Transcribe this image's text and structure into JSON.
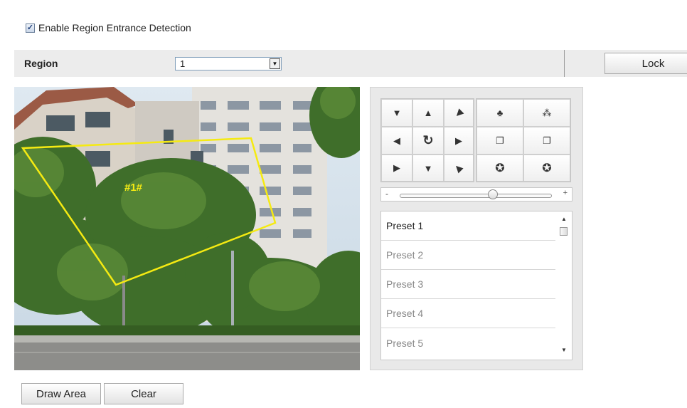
{
  "enable": {
    "label": "Enable Region Entrance Detection",
    "checked": true
  },
  "region": {
    "label": "Region",
    "value": "1",
    "lock_label": "Lock"
  },
  "video": {
    "overlay_label": "#1#",
    "overlay_color": "#f5ea12"
  },
  "ptz": {
    "directions": [
      {
        "name": "up-left",
        "glyph": "▼"
      },
      {
        "name": "up",
        "glyph": "▲"
      },
      {
        "name": "up-right",
        "glyph": "◀"
      },
      {
        "name": "left",
        "glyph": "◀"
      },
      {
        "name": "auto",
        "glyph": "↻"
      },
      {
        "name": "right",
        "glyph": "▶"
      },
      {
        "name": "down-left",
        "glyph": "▶"
      },
      {
        "name": "down",
        "glyph": "▼"
      },
      {
        "name": "down-right",
        "glyph": "◀"
      }
    ],
    "lens": [
      {
        "name": "zoom-in-icon",
        "glyph": "♣"
      },
      {
        "name": "zoom-out-icon",
        "glyph": "⁂"
      },
      {
        "name": "focus-near-icon",
        "glyph": "❐"
      },
      {
        "name": "focus-far-icon",
        "glyph": "❐"
      },
      {
        "name": "iris-open-icon",
        "glyph": "✪"
      },
      {
        "name": "iris-close-icon",
        "glyph": "✪"
      }
    ],
    "speed": {
      "minus": "-",
      "plus": "+",
      "level": 0.62
    }
  },
  "presets": [
    {
      "label": "Preset 1",
      "active": true
    },
    {
      "label": "Preset 2",
      "active": false
    },
    {
      "label": "Preset 3",
      "active": false
    },
    {
      "label": "Preset 4",
      "active": false
    },
    {
      "label": "Preset 5",
      "active": false
    }
  ],
  "buttons": {
    "draw_area": "Draw Area",
    "clear": "Clear"
  }
}
